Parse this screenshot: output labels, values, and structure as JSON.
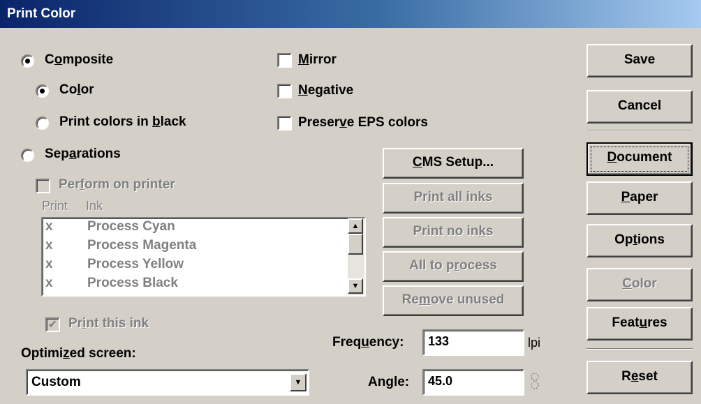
{
  "window": {
    "title": "Print Color"
  },
  "output_mode": {
    "composite_label": "Composite",
    "composite_accel": "o",
    "color_label": "Color",
    "color_accel": "l",
    "black_label": "Print colors in black",
    "black_accel": "b",
    "separations_label": "Separations",
    "separations_accel": "a"
  },
  "options": {
    "mirror_label": "Mirror",
    "mirror_accel": "M",
    "negative_label": "Negative",
    "negative_accel": "N",
    "preserve_label": "Preserve EPS colors",
    "preserve_accel": "v"
  },
  "separations": {
    "perform_label": "Perform on printer",
    "perform_accel": "f",
    "col_print": "Print",
    "col_ink": "Ink",
    "inks": [
      {
        "print": "x",
        "name": "Process Cyan"
      },
      {
        "print": "x",
        "name": "Process Magenta"
      },
      {
        "print": "x",
        "name": "Process Yellow"
      },
      {
        "print": "x",
        "name": "Process Black"
      }
    ],
    "print_this_ink_label": "Print this ink",
    "print_this_ink_accel": "i",
    "print_this_ink_checked": "✔"
  },
  "ink_buttons": {
    "cms_setup": "CMS Setup...",
    "cms_accel": "C",
    "print_all": "Print all inks",
    "print_all_accel": "i",
    "print_none": "Print no inks",
    "print_none_accel": "k",
    "all_to_process": "All to process",
    "all_to_process_accel": "r",
    "remove_unused": "Remove unused",
    "remove_unused_accel": "m"
  },
  "screen": {
    "optimized_label": "Optimized screen:",
    "optimized_accel": "z",
    "selected": "Custom",
    "frequency_label": "Frequency:",
    "frequency_accel": "u",
    "frequency_value": "133",
    "frequency_unit": "lpi",
    "angle_label": "Angle:",
    "angle_accel": "g",
    "angle_value": "45.0"
  },
  "side_buttons": {
    "save": "Save",
    "cancel": "Cancel",
    "document": "Document",
    "document_accel": "D",
    "paper": "Paper",
    "paper_accel": "P",
    "options": "Options",
    "options_accel": "t",
    "color": "Color",
    "color_accel": "C",
    "features": "Features",
    "features_accel": "u",
    "reset": "Reset",
    "reset_accel": "e"
  },
  "colors": {
    "face": "#d4d0c8",
    "title_start": "#0a246a",
    "title_end": "#a6caf0",
    "disabled_text": "#808080"
  }
}
